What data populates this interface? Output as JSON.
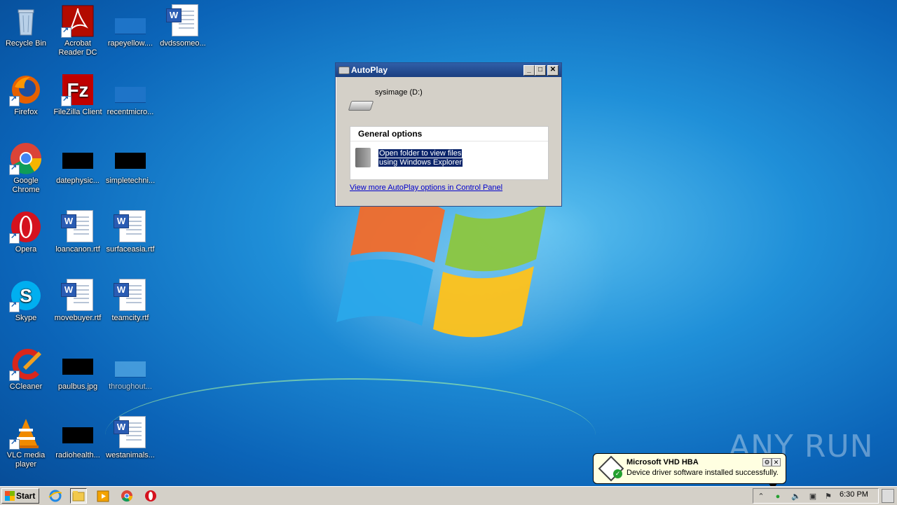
{
  "desktop": {
    "icons": [
      {
        "label": "Recycle Bin"
      },
      {
        "label": "Acrobat\nReader DC"
      },
      {
        "label": "rapeyellow...."
      },
      {
        "label": "dvdssomeo..."
      },
      {
        "label": "Firefox"
      },
      {
        "label": "FileZilla Client"
      },
      {
        "label": "recentmicro..."
      },
      {
        "label": "Google\nChrome"
      },
      {
        "label": "datephysic..."
      },
      {
        "label": "simpletechni..."
      },
      {
        "label": "Opera"
      },
      {
        "label": "loancanon.rtf"
      },
      {
        "label": "surfaceasia.rtf"
      },
      {
        "label": "Skype"
      },
      {
        "label": "movebuyer.rtf"
      },
      {
        "label": "teamcity.rtf"
      },
      {
        "label": "CCleaner"
      },
      {
        "label": "paulbus.jpg"
      },
      {
        "label": "throughout..."
      },
      {
        "label": "VLC media\nplayer"
      },
      {
        "label": "radiohealth..."
      },
      {
        "label": "westanimals..."
      }
    ]
  },
  "autoplay": {
    "title": "AutoPlay",
    "drive_label": "sysimage (D:)",
    "section_title": "General options",
    "option_line1": "Open folder to view files",
    "option_line2": "using Windows Explorer",
    "more_link": "View more AutoPlay options in Control Panel"
  },
  "notification": {
    "title": "Microsoft VHD HBA",
    "body": "Device driver software installed successfully."
  },
  "watermark": "ANY RUN",
  "taskbar": {
    "start_label": "Start",
    "clock": "6:30 PM"
  }
}
